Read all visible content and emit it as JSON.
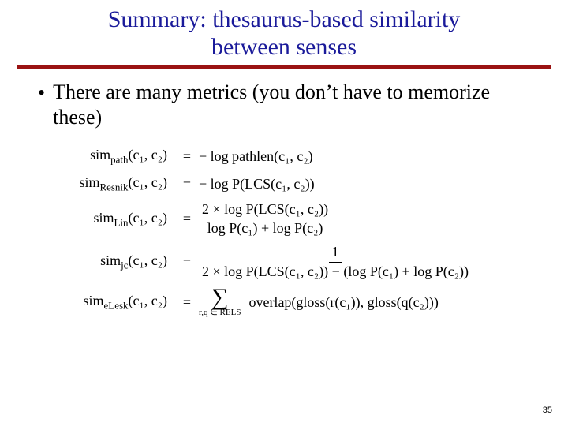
{
  "title_line1": "Summary: thesaurus-based similarity",
  "title_line2": "between senses",
  "bullet": "There are many metrics (you don’t have to memorize these)",
  "eq": {
    "path": {
      "name": "sim",
      "sub": "path",
      "args": "(c₁, c₂)",
      "rhs": "− log pathlen(c₁, c₂)"
    },
    "resnik": {
      "name": "sim",
      "sub": "Resnik",
      "args": "(c₁, c₂)",
      "rhs": "− log P(LCS(c₁, c₂))"
    },
    "lin": {
      "name": "sim",
      "sub": "Lin",
      "args": "(c₁, c₂)",
      "num": "2 × log P(LCS(c₁, c₂))",
      "den": "log P(c₁) + log P(c₂)"
    },
    "jc": {
      "name": "sim",
      "sub": "jc",
      "args": "(c₁, c₂)",
      "num": "1",
      "den": "2 × log P(LCS(c₁, c₂)) − (log P(c₁) + log P(c₂))"
    },
    "elesk": {
      "name": "sim",
      "sub": "eLesk",
      "args": "(c₁, c₂)",
      "sumlow": "r,q ∈ RELS",
      "rhs": "overlap(gloss(r(c₁)), gloss(q(c₂)))"
    }
  },
  "page_number": "35"
}
